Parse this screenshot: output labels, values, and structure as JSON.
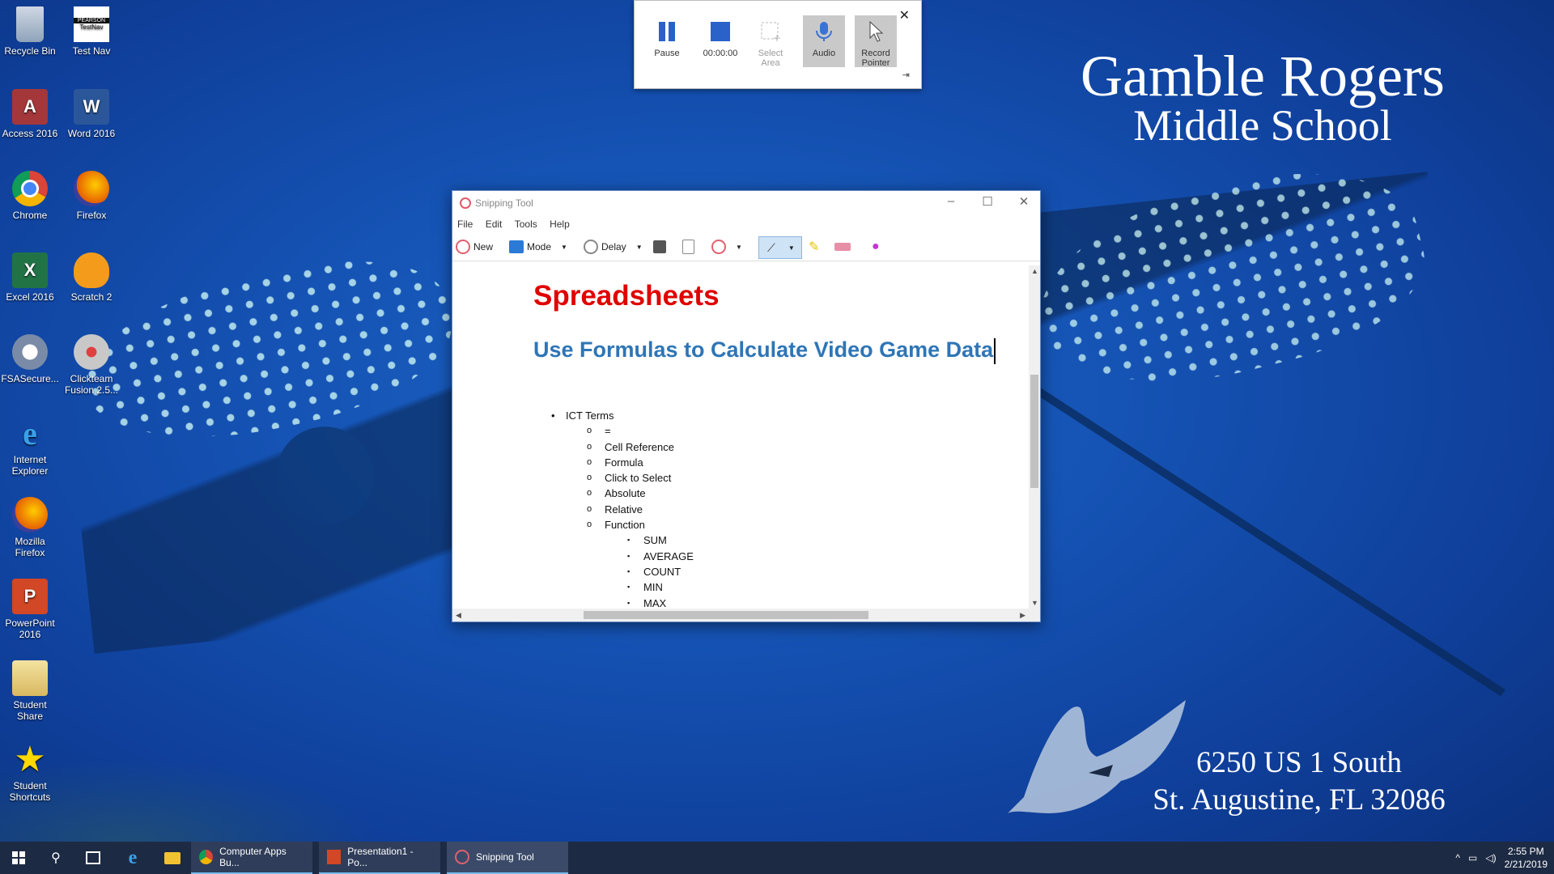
{
  "desktop": {
    "icons": [
      {
        "label": "Recycle Bin"
      },
      {
        "label": "Test Nav",
        "badge": "PEARSON",
        "inner": "TestNav"
      },
      {
        "label": "Access 2016",
        "glyph": "A"
      },
      {
        "label": "Word 2016",
        "glyph": "W"
      },
      {
        "label": "Chrome"
      },
      {
        "label": "Firefox"
      },
      {
        "label": "Excel 2016",
        "glyph": "X"
      },
      {
        "label": "Scratch 2"
      },
      {
        "label": "FSASecure..."
      },
      {
        "label": "Clickteam Fusion 2.5..."
      },
      {
        "label": "Internet Explorer",
        "glyph": "e"
      },
      {
        "label": "Mozilla Firefox"
      },
      {
        "label": "PowerPoint 2016",
        "glyph": "P"
      },
      {
        "label": "Student Share"
      },
      {
        "label": "Student Shortcuts",
        "glyph": "★"
      }
    ],
    "school_line1": "Gamble Rogers",
    "school_line2": "Middle School",
    "address_line1": "6250 US 1 South",
    "address_line2": "St. Augustine, FL 32086"
  },
  "recorder": {
    "pause_label": "Pause",
    "timer": "00:00:00",
    "select_area_label": "Select Area",
    "audio_label": "Audio",
    "record_pointer_label": "Record Pointer",
    "close_glyph": "✕",
    "pin_glyph": "⇥"
  },
  "snipping_tool": {
    "title": "Snipping Tool",
    "menu": [
      "File",
      "Edit",
      "Tools",
      "Help"
    ],
    "toolbar": {
      "new_label": "New",
      "mode_label": "Mode",
      "delay_label": "Delay"
    },
    "document": {
      "heading": "Spreadsheets",
      "subheading": "Use Formulas to Calculate Video Game Data",
      "list_top": "ICT Terms",
      "terms": [
        "=",
        "Cell Reference",
        "Formula",
        "Click to Select",
        "Absolute",
        "Relative",
        "Function"
      ],
      "functions": [
        "SUM",
        "AVERAGE",
        "COUNT",
        "MIN",
        "MAX"
      ]
    }
  },
  "taskbar": {
    "apps": [
      {
        "label": "Computer Apps Bu..."
      },
      {
        "label": "Presentation1 - Po..."
      },
      {
        "label": "Snipping Tool"
      }
    ],
    "time": "2:55 PM",
    "date": "2/21/2019"
  },
  "colors": {
    "heading_red": "#e00000",
    "subheading_blue": "#2e75b6",
    "taskbar_bg": "#1d2a44"
  }
}
